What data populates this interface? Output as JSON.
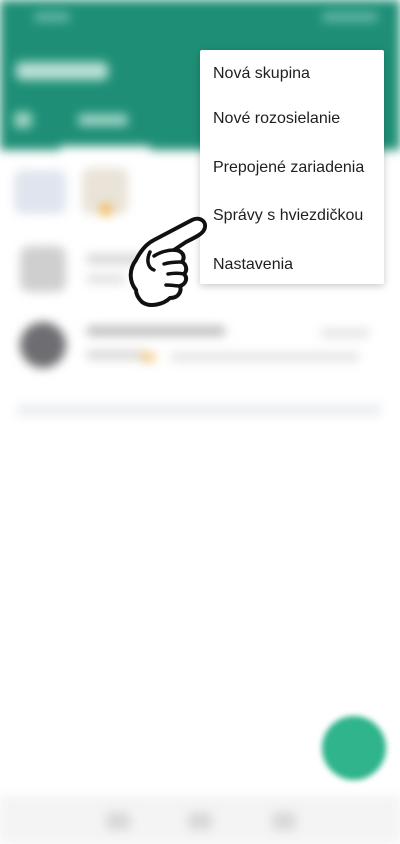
{
  "menu": {
    "items": [
      {
        "label": "Nová skupina"
      },
      {
        "label": "Nové rozosielanie"
      },
      {
        "label": "Prepojené zariadenia"
      },
      {
        "label": "Správy s hviezdičkou"
      },
      {
        "label": "Nastavenia"
      }
    ]
  },
  "colors": {
    "header": "#1e8f76",
    "fab": "#2fb48c",
    "menu_background": "#ffffff",
    "menu_text": "#1f1f1f"
  },
  "icons": {
    "pointer": "pointing-hand-icon",
    "fab": "new-chat-icon"
  }
}
